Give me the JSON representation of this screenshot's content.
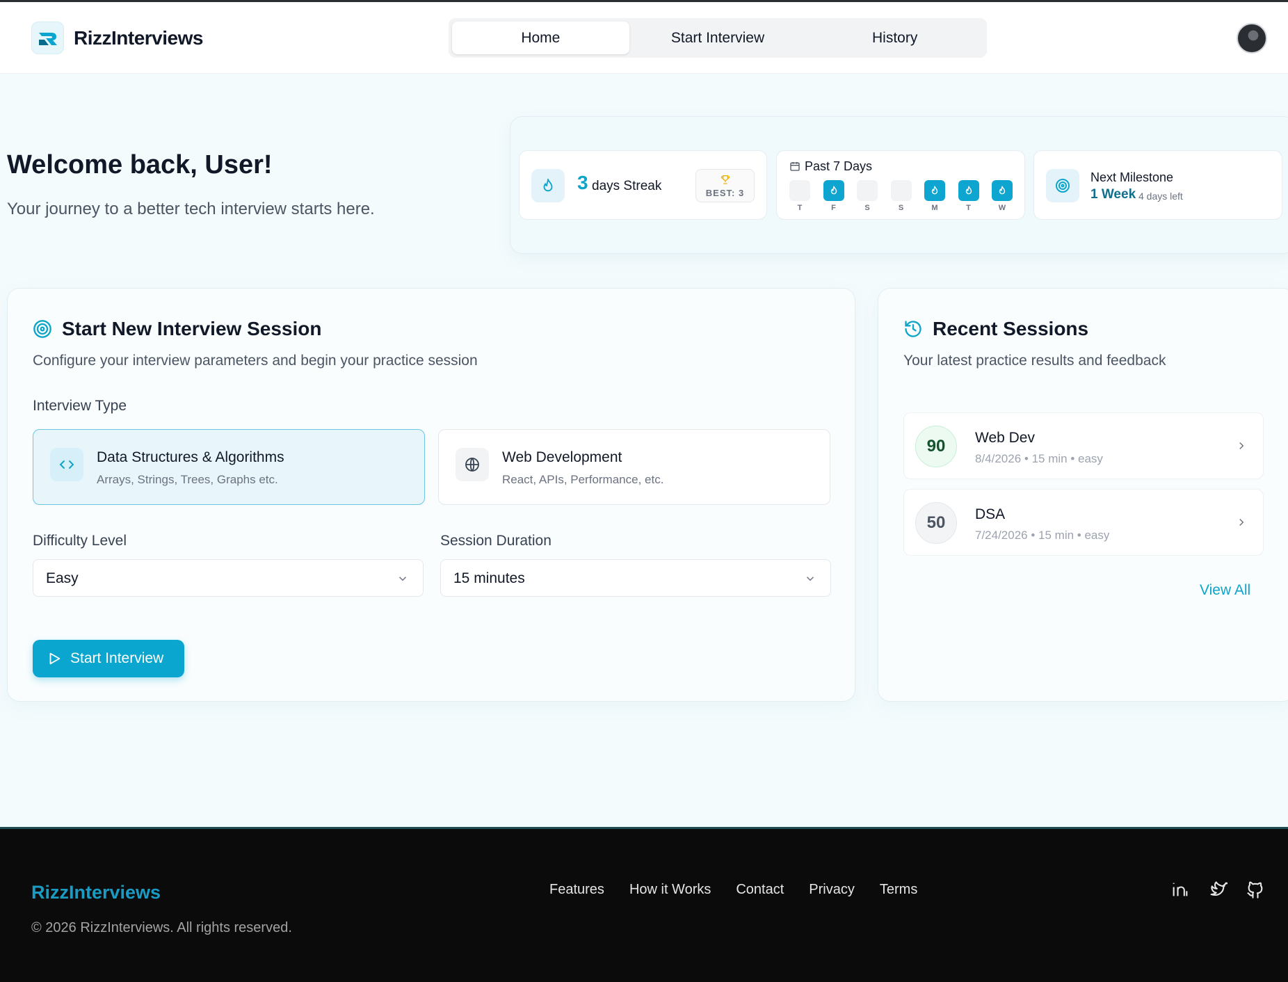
{
  "app": {
    "name": "RizzInterviews"
  },
  "nav": {
    "tabs": [
      "Home",
      "Start Interview",
      "History"
    ],
    "active": 0
  },
  "welcome": {
    "title": "Welcome back, User!",
    "subtitle": "Your journey to a better tech interview starts here."
  },
  "stats": {
    "streak": {
      "count": "3",
      "label": "days Streak",
      "best": "BEST: 3"
    },
    "past7": {
      "title": "Past 7 Days",
      "days": [
        {
          "label": "T",
          "active": false
        },
        {
          "label": "F",
          "active": true
        },
        {
          "label": "S",
          "active": false
        },
        {
          "label": "S",
          "active": false
        },
        {
          "label": "M",
          "active": true
        },
        {
          "label": "T",
          "active": true
        },
        {
          "label": "W",
          "active": true
        }
      ]
    },
    "milestone": {
      "title": "Next Milestone",
      "value": "1 Week",
      "remaining": "4 days left"
    }
  },
  "session": {
    "title": "Start New Interview Session",
    "subtitle": "Configure your interview parameters and begin your practice session",
    "type_label": "Interview Type",
    "types": [
      {
        "name": "Data Structures & Algorithms",
        "desc": "Arrays, Strings, Trees, Graphs etc."
      },
      {
        "name": "Web Development",
        "desc": "React, APIs, Performance, etc."
      }
    ],
    "difficulty_label": "Difficulty Level",
    "difficulty_value": "Easy",
    "duration_label": "Session Duration",
    "duration_value": "15 minutes",
    "start_label": "Start Interview"
  },
  "recent": {
    "title": "Recent Sessions",
    "subtitle": "Your latest practice results and feedback",
    "items": [
      {
        "score": "90",
        "name": "Web Dev",
        "meta": "8/4/2026 • 15 min • easy"
      },
      {
        "score": "50",
        "name": "DSA",
        "meta": "7/24/2026 • 15 min • easy"
      }
    ],
    "view_all": "View All"
  },
  "footer": {
    "brand": "RizzInterviews",
    "copyright": "© 2026 RizzInterviews. All rights reserved.",
    "links": [
      "Features",
      "How it Works",
      "Contact",
      "Privacy",
      "Terms"
    ]
  },
  "colors": {
    "accent": "#0aa6d0",
    "brand": "#1a9bc4"
  }
}
